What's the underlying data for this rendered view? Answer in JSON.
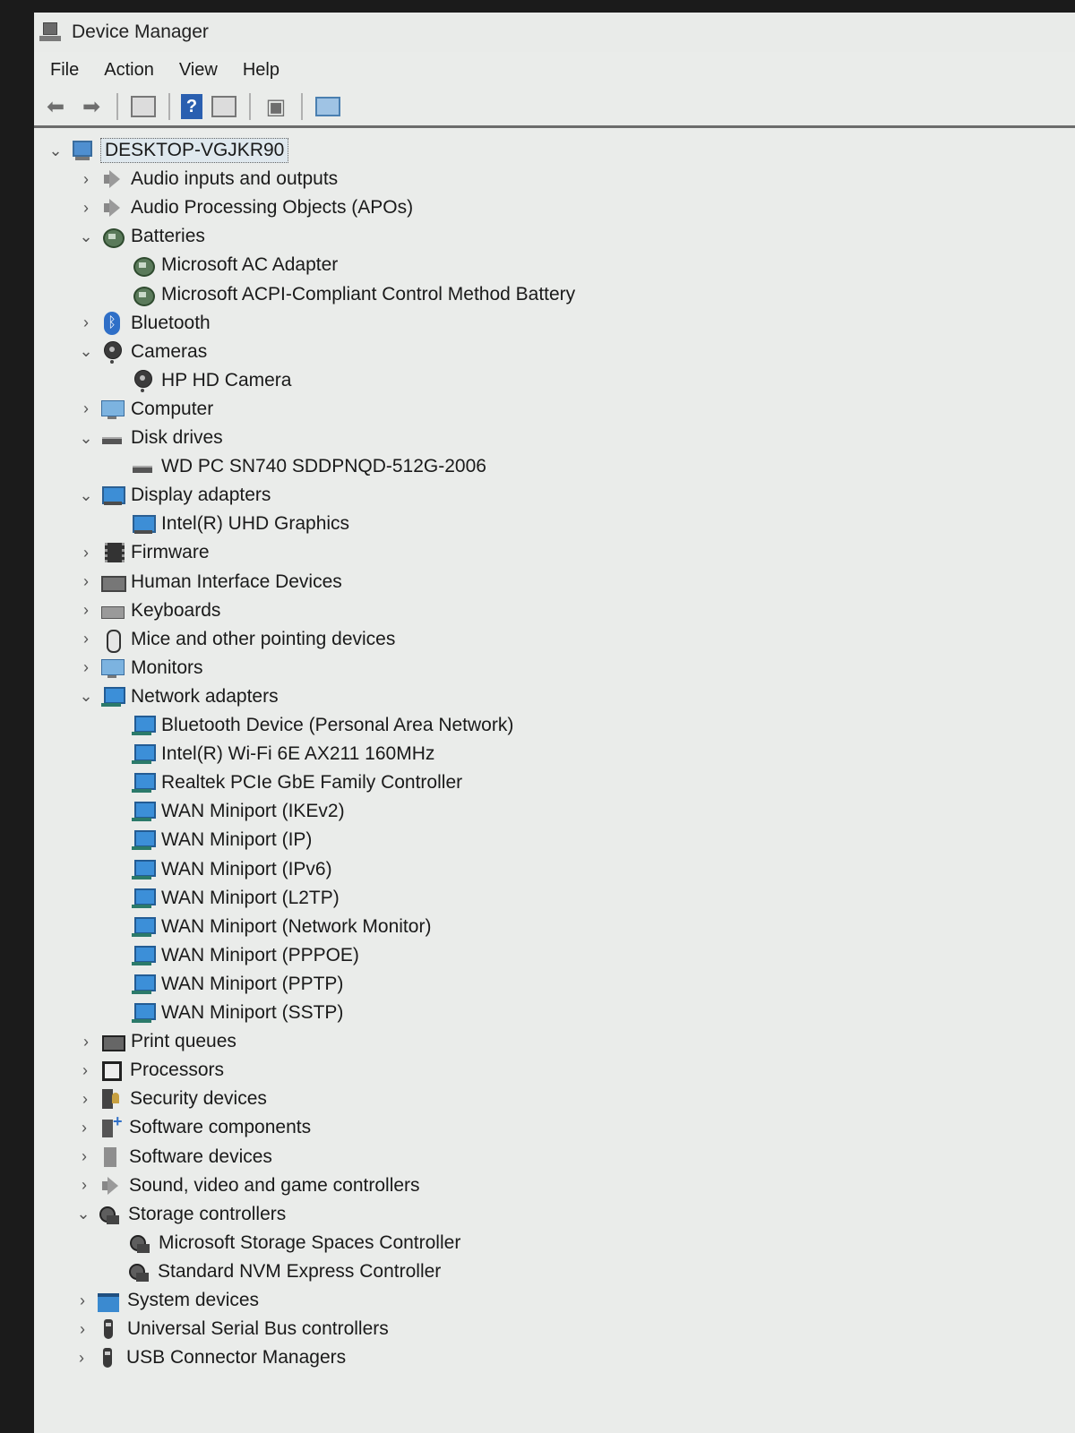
{
  "window": {
    "title": "Device Manager"
  },
  "menu": [
    "File",
    "Action",
    "View",
    "Help"
  ],
  "toolbar": {
    "help_glyph": "?"
  },
  "tree": [
    {
      "label": "DESKTOP-VGJKR90",
      "level": 0,
      "state": "expanded",
      "icon": "computer-icon",
      "root": true
    },
    {
      "label": "Audio inputs and outputs",
      "level": 1,
      "state": "collapsed",
      "icon": "speaker-icon"
    },
    {
      "label": "Audio Processing Objects (APOs)",
      "level": 1,
      "state": "collapsed",
      "icon": "speaker-icon"
    },
    {
      "label": "Batteries",
      "level": 1,
      "state": "expanded",
      "icon": "battery-icon"
    },
    {
      "label": "Microsoft AC Adapter",
      "level": 2,
      "state": "leaf",
      "icon": "battery-icon"
    },
    {
      "label": "Microsoft ACPI-Compliant Control Method Battery",
      "level": 2,
      "state": "leaf",
      "icon": "battery-icon"
    },
    {
      "label": "Bluetooth",
      "level": 1,
      "state": "collapsed",
      "icon": "bluetooth-icon"
    },
    {
      "label": "Cameras",
      "level": 1,
      "state": "expanded",
      "icon": "camera-icon"
    },
    {
      "label": "HP HD Camera",
      "level": 2,
      "state": "leaf",
      "icon": "camera-icon"
    },
    {
      "label": "Computer",
      "level": 1,
      "state": "collapsed",
      "icon": "monitor-icon"
    },
    {
      "label": "Disk drives",
      "level": 1,
      "state": "expanded",
      "icon": "disk-icon"
    },
    {
      "label": "WD PC SN740 SDDPNQD-512G-2006",
      "level": 2,
      "state": "leaf",
      "icon": "disk-icon"
    },
    {
      "label": "Display adapters",
      "level": 1,
      "state": "expanded",
      "icon": "display-icon"
    },
    {
      "label": "Intel(R) UHD Graphics",
      "level": 2,
      "state": "leaf",
      "icon": "display-icon"
    },
    {
      "label": "Firmware",
      "level": 1,
      "state": "collapsed",
      "icon": "chip-icon"
    },
    {
      "label": "Human Interface Devices",
      "level": 1,
      "state": "collapsed",
      "icon": "hid-icon"
    },
    {
      "label": "Keyboards",
      "level": 1,
      "state": "collapsed",
      "icon": "keyboard-icon"
    },
    {
      "label": "Mice and other pointing devices",
      "level": 1,
      "state": "collapsed",
      "icon": "mouse-icon"
    },
    {
      "label": "Monitors",
      "level": 1,
      "state": "collapsed",
      "icon": "monitor-icon"
    },
    {
      "label": "Network adapters",
      "level": 1,
      "state": "expanded",
      "icon": "network-icon"
    },
    {
      "label": "Bluetooth Device (Personal Area Network)",
      "level": 2,
      "state": "leaf",
      "icon": "network-icon"
    },
    {
      "label": "Intel(R) Wi-Fi 6E AX211 160MHz",
      "level": 2,
      "state": "leaf",
      "icon": "network-icon"
    },
    {
      "label": "Realtek PCIe GbE Family Controller",
      "level": 2,
      "state": "leaf",
      "icon": "network-icon"
    },
    {
      "label": "WAN Miniport (IKEv2)",
      "level": 2,
      "state": "leaf",
      "icon": "network-icon"
    },
    {
      "label": "WAN Miniport (IP)",
      "level": 2,
      "state": "leaf",
      "icon": "network-icon"
    },
    {
      "label": "WAN Miniport (IPv6)",
      "level": 2,
      "state": "leaf",
      "icon": "network-icon"
    },
    {
      "label": "WAN Miniport (L2TP)",
      "level": 2,
      "state": "leaf",
      "icon": "network-icon"
    },
    {
      "label": "WAN Miniport (Network Monitor)",
      "level": 2,
      "state": "leaf",
      "icon": "network-icon"
    },
    {
      "label": "WAN Miniport (PPPOE)",
      "level": 2,
      "state": "leaf",
      "icon": "network-icon"
    },
    {
      "label": "WAN Miniport (PPTP)",
      "level": 2,
      "state": "leaf",
      "icon": "network-icon"
    },
    {
      "label": "WAN Miniport (SSTP)",
      "level": 2,
      "state": "leaf",
      "icon": "network-icon"
    },
    {
      "label": "Print queues",
      "level": 1,
      "state": "collapsed",
      "icon": "printer-icon"
    },
    {
      "label": "Processors",
      "level": 1,
      "state": "collapsed",
      "icon": "processor-icon"
    },
    {
      "label": "Security devices",
      "level": 1,
      "state": "collapsed",
      "icon": "security-icon"
    },
    {
      "label": "Software components",
      "level": 1,
      "state": "collapsed",
      "icon": "software-icon"
    },
    {
      "label": "Software devices",
      "level": 1,
      "state": "collapsed",
      "icon": "softdev-icon"
    },
    {
      "label": "Sound, video and game controllers",
      "level": 1,
      "state": "collapsed",
      "icon": "speaker-icon"
    },
    {
      "label": "Storage controllers",
      "level": 1,
      "state": "expanded",
      "icon": "storage-icon"
    },
    {
      "label": "Microsoft Storage Spaces Controller",
      "level": 2,
      "state": "leaf",
      "icon": "storage-icon"
    },
    {
      "label": "Standard NVM Express Controller",
      "level": 2,
      "state": "leaf",
      "icon": "storage-icon"
    },
    {
      "label": "System devices",
      "level": 1,
      "state": "collapsed",
      "icon": "folder-icon"
    },
    {
      "label": "Universal Serial Bus controllers",
      "level": 1,
      "state": "collapsed",
      "icon": "usb-icon"
    },
    {
      "label": "USB Connector Managers",
      "level": 1,
      "state": "collapsed",
      "icon": "usb-icon"
    }
  ]
}
